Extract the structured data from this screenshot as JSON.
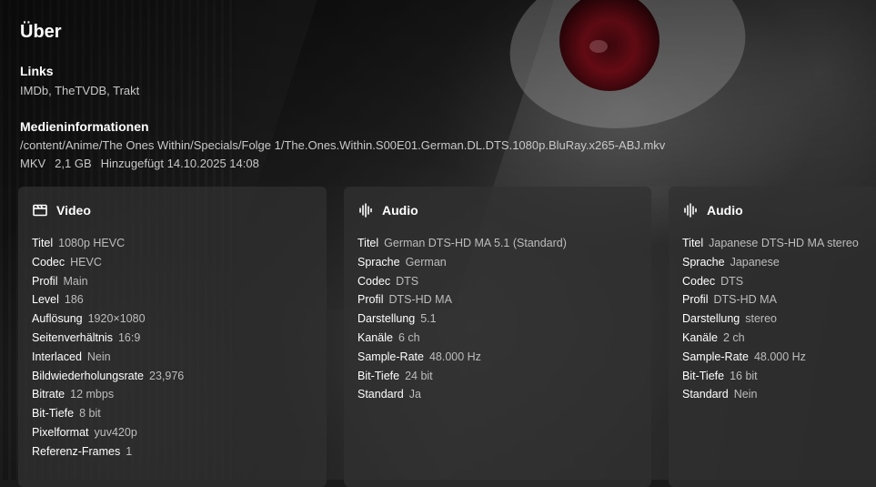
{
  "page": {
    "title": "Über"
  },
  "links": {
    "heading": "Links",
    "items": [
      {
        "label": "IMDb"
      },
      {
        "label": "TheTVDB"
      },
      {
        "label": "Trakt"
      }
    ]
  },
  "media": {
    "heading": "Medieninformationen",
    "path": "/content/Anime/The Ones Within/Specials/Folge 1/The.Ones.Within.S00E01.German.DL.DTS.1080p.BluRay.x265-ABJ.mkv",
    "container": "MKV",
    "size": "2,1 GB",
    "added": "Hinzugefügt 14.10.2025 14:08"
  },
  "streams": [
    {
      "title": "Video",
      "icon": "film-icon",
      "rows": [
        {
          "key": "Titel",
          "value": "1080p HEVC"
        },
        {
          "key": "Codec",
          "value": "HEVC"
        },
        {
          "key": "Profil",
          "value": "Main"
        },
        {
          "key": "Level",
          "value": "186"
        },
        {
          "key": "Auflösung",
          "value": "1920×1080"
        },
        {
          "key": "Seitenverhältnis",
          "value": "16:9"
        },
        {
          "key": "Interlaced",
          "value": "Nein"
        },
        {
          "key": "Bildwiederholungsrate",
          "value": "23,976"
        },
        {
          "key": "Bitrate",
          "value": "12 mbps"
        },
        {
          "key": "Bit-Tiefe",
          "value": "8 bit"
        },
        {
          "key": "Pixelformat",
          "value": "yuv420p"
        },
        {
          "key": "Referenz-Frames",
          "value": "1"
        }
      ]
    },
    {
      "title": "Audio",
      "icon": "audio-waveform-icon",
      "rows": [
        {
          "key": "Titel",
          "value": "German DTS-HD MA 5.1 (Standard)"
        },
        {
          "key": "Sprache",
          "value": "German"
        },
        {
          "key": "Codec",
          "value": "DTS"
        },
        {
          "key": "Profil",
          "value": "DTS-HD MA"
        },
        {
          "key": "Darstellung",
          "value": "5.1"
        },
        {
          "key": "Kanäle",
          "value": "6 ch"
        },
        {
          "key": "Sample-Rate",
          "value": "48.000 Hz"
        },
        {
          "key": "Bit-Tiefe",
          "value": "24 bit"
        },
        {
          "key": "Standard",
          "value": "Ja"
        }
      ]
    },
    {
      "title": "Audio",
      "icon": "audio-waveform-icon",
      "rows": [
        {
          "key": "Titel",
          "value": "Japanese DTS-HD MA stereo"
        },
        {
          "key": "Sprache",
          "value": "Japanese"
        },
        {
          "key": "Codec",
          "value": "DTS"
        },
        {
          "key": "Profil",
          "value": "DTS-HD MA"
        },
        {
          "key": "Darstellung",
          "value": "stereo"
        },
        {
          "key": "Kanäle",
          "value": "2 ch"
        },
        {
          "key": "Sample-Rate",
          "value": "48.000 Hz"
        },
        {
          "key": "Bit-Tiefe",
          "value": "16 bit"
        },
        {
          "key": "Standard",
          "value": "Nein"
        }
      ]
    }
  ]
}
